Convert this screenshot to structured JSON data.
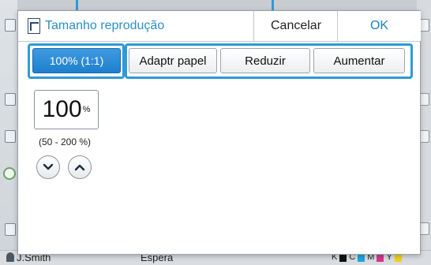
{
  "dialog": {
    "title": "Tamanho reprodução",
    "cancel_label": "Cancelar",
    "ok_label": "OK"
  },
  "modes": [
    {
      "label": "100% (1:1)",
      "selected": true
    },
    {
      "label": "Adaptr papel",
      "selected": false
    },
    {
      "label": "Reduzir",
      "selected": false
    },
    {
      "label": "Aumentar",
      "selected": false
    }
  ],
  "zoom": {
    "value": "100",
    "unit": "%",
    "range": "(50 - 200 %)"
  },
  "statusbar": {
    "user": "J.Smith",
    "state": "Espera",
    "ink_labels": [
      "K",
      "C",
      "M",
      "Y"
    ]
  },
  "colors": {
    "accent": "#2e9ad8",
    "selected_button": "#2a89d4",
    "ink_k": "#111111",
    "ink_c": "#1fa6e0",
    "ink_m": "#d8368e",
    "ink_y": "#f2d21b"
  },
  "icons": {
    "title": "document-icon",
    "decrease": "chevron-down-icon",
    "increase": "chevron-up-icon"
  }
}
